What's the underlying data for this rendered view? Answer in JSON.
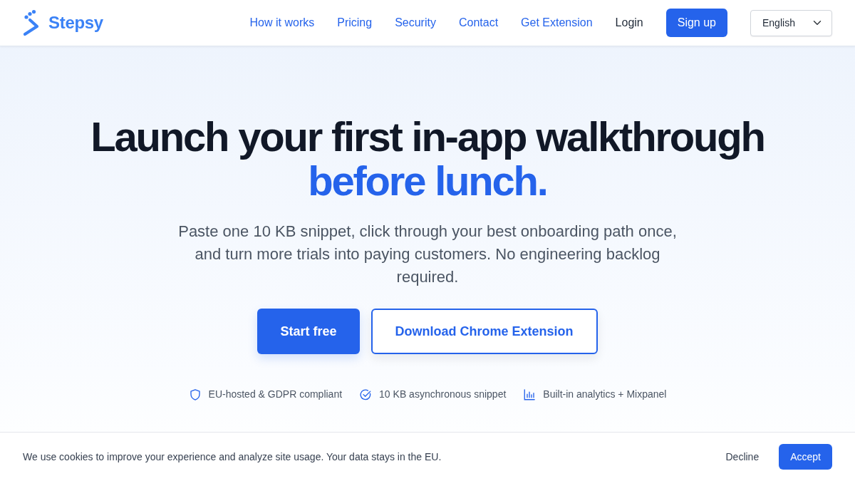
{
  "brand": {
    "name": "Stepsy"
  },
  "nav": {
    "links": [
      {
        "label": "How it works"
      },
      {
        "label": "Pricing"
      },
      {
        "label": "Security"
      },
      {
        "label": "Contact"
      },
      {
        "label": "Get Extension"
      }
    ],
    "login": "Login",
    "signup": "Sign up",
    "language": {
      "value": "English"
    }
  },
  "hero": {
    "title": "Launch your first in-app walkthrough",
    "highlight": "before lunch.",
    "subtitle": "Paste one 10 KB snippet, click through your best onboarding path once, and turn more trials into paying customers. No engineering backlog required.",
    "primary_button": "Start free",
    "secondary_button": "Download Chrome Extension",
    "features": [
      {
        "kind": "shield",
        "label": "EU-hosted & GDPR compliant"
      },
      {
        "kind": "check",
        "label": "10 KB asynchronous snippet"
      },
      {
        "kind": "chart",
        "label": "Built-in analytics + Mixpanel"
      }
    ]
  },
  "cookie_banner": {
    "text": "We use cookies to improve your experience and analyze site usage. Your data stays in the EU.",
    "decline": "Decline",
    "accept": "Accept"
  }
}
